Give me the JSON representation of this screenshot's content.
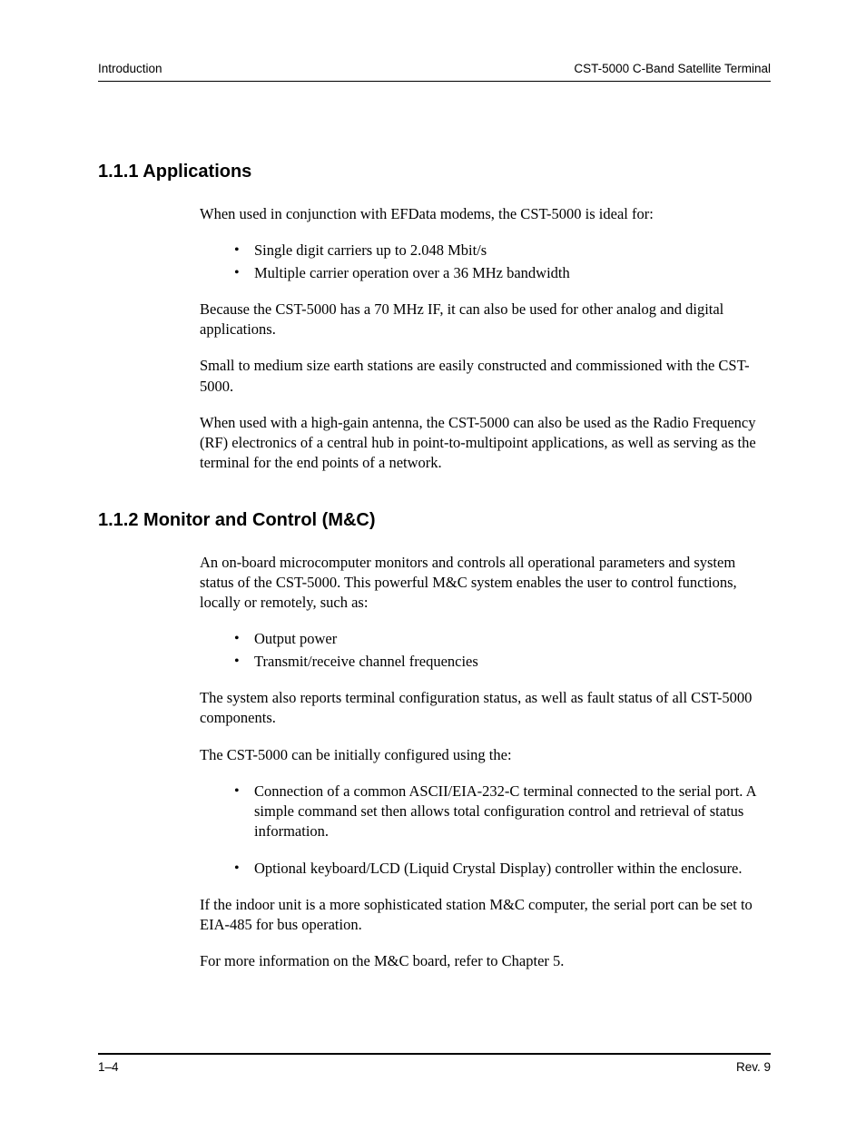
{
  "header": {
    "left": "Introduction",
    "right": "CST-5000 C-Band Satellite Terminal"
  },
  "sections": [
    {
      "number": "1.1.1",
      "title": "Applications",
      "blocks": [
        {
          "type": "para",
          "text": "When used in conjunction with EFData modems, the CST-5000 is ideal for:"
        },
        {
          "type": "bullets",
          "items": [
            "Single digit carriers up to 2.048 Mbit/s",
            "Multiple carrier operation over a 36 MHz bandwidth"
          ]
        },
        {
          "type": "para",
          "text": "Because the CST-5000 has a 70 MHz IF, it can also be used for other analog and digital applications."
        },
        {
          "type": "para",
          "text": "Small to medium size earth stations are easily constructed and commissioned with the CST-5000."
        },
        {
          "type": "para",
          "text": "When used with a high-gain antenna, the CST-5000 can also be used as the Radio Frequency (RF) electronics of a central hub in point-to-multipoint applications, as well as serving as the terminal for the end points of a network."
        }
      ]
    },
    {
      "number": "1.1.2",
      "title": "Monitor and Control (M&C)",
      "blocks": [
        {
          "type": "para",
          "text": "An on-board microcomputer monitors and controls all operational parameters and system status of the CST-5000. This powerful M&C system enables the user to control functions, locally or remotely, such as:"
        },
        {
          "type": "bullets",
          "items": [
            "Output power",
            "Transmit/receive channel frequencies"
          ]
        },
        {
          "type": "para",
          "text": "The system also reports terminal configuration status, as well as fault status of all CST-5000 components."
        },
        {
          "type": "para",
          "text": "The CST-5000 can be initially configured using the:"
        },
        {
          "type": "bullets-spaced",
          "items": [
            "Connection of a common ASCII/EIA-232-C terminal connected to the serial port. A simple command set then allows total configuration control and retrieval of status information.",
            "Optional keyboard/LCD (Liquid Crystal Display) controller within the enclosure."
          ]
        },
        {
          "type": "para",
          "text": "If the indoor unit is a more sophisticated station M&C computer, the serial port can be set to EIA-485 for bus operation."
        },
        {
          "type": "para",
          "text": "For more information on the M&C board, refer to Chapter 5."
        }
      ]
    }
  ],
  "footer": {
    "left": "1–4",
    "right": "Rev. 9"
  }
}
